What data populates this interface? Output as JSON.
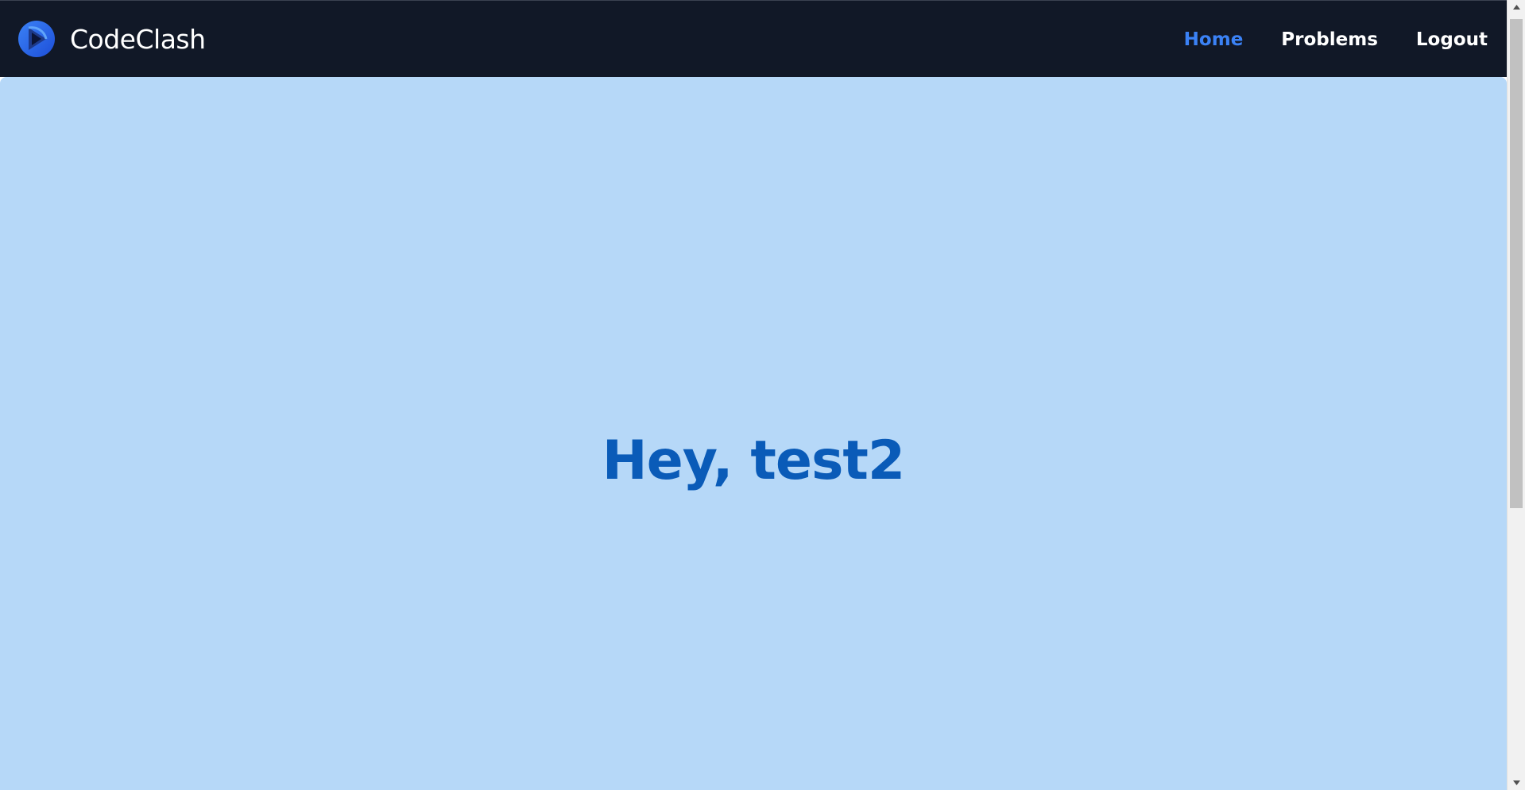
{
  "navbar": {
    "brand_name": "CodeClash",
    "logo_icon": "codeclash-logo-icon",
    "links": [
      {
        "label": "Home",
        "active": true
      },
      {
        "label": "Problems",
        "active": false
      },
      {
        "label": "Logout",
        "active": false
      }
    ]
  },
  "hero": {
    "greeting": "Hey, test2"
  },
  "colors": {
    "navbar_bg": "#111827",
    "active_link": "#3b82f6",
    "hero_bg": "#b6d8f8",
    "greeting_text": "#0a5bb8"
  },
  "scrollbar": {
    "up_icon": "scroll-up-arrow-icon",
    "down_icon": "scroll-down-arrow-icon"
  }
}
